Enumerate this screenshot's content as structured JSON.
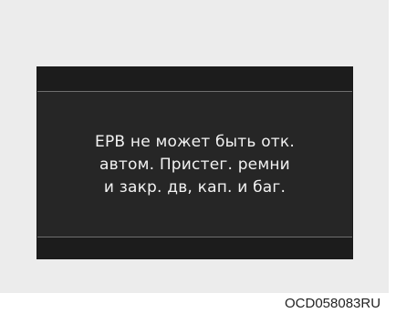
{
  "display": {
    "message_lines": [
      "EPB не может быть отк.",
      "автом. Пристег. ремни",
      "и закр. дв, кап. и баг."
    ]
  },
  "image_code": "OCD058083RU"
}
